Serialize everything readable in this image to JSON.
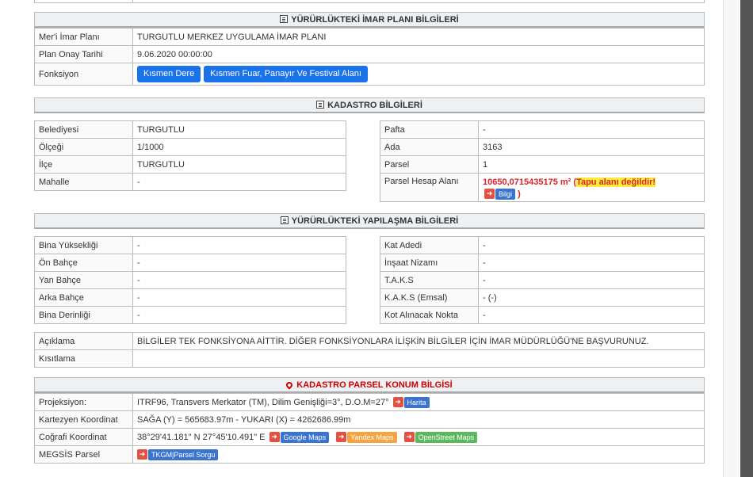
{
  "imar": {
    "title": "YÜRÜRLÜKTEKİ İMAR PLANI BİLGİLERİ",
    "rows": [
      {
        "label": "Mer'i İmar Planı",
        "value": "TURGUTLU MERKEZ UYGULAMA İMAR PLANI"
      },
      {
        "label": "Plan Onay Tarihi",
        "value": "9.06.2020 00:00:00"
      }
    ],
    "fonksiyon_label": "Fonksiyon",
    "fonksiyon_buttons": [
      "Kısmen Dere",
      "Kısmen Fuar, Panayır Ve Festival Alanı"
    ]
  },
  "kadastro": {
    "title": "KADASTRO BİLGİLERİ",
    "left": [
      {
        "label": "Belediyesi",
        "value": "TURGUTLU"
      },
      {
        "label": "Ölçeği",
        "value": "1/1000"
      },
      {
        "label": "İlçe",
        "value": "TURGUTLU"
      },
      {
        "label": "Mahalle",
        "value": "-"
      }
    ],
    "right": [
      {
        "label": "Pafta",
        "value": "-"
      },
      {
        "label": "Ada",
        "value": "3163"
      },
      {
        "label": "Parsel",
        "value": "1"
      }
    ],
    "alan_label": "Parsel Hesap Alanı",
    "alan_value": "10650,0715435175 m²",
    "alan_open": " (",
    "alan_warning": "Tapu alanı değildir!",
    "bilgi_label": "Bilgi",
    "alan_close": " )"
  },
  "yapilasma": {
    "title": "YÜRÜRLÜKTEKİ YAPILAŞMA BİLGİLERİ",
    "left": [
      {
        "label": "Bina Yüksekliği",
        "value": "-"
      },
      {
        "label": "Ön Bahçe",
        "value": "-"
      },
      {
        "label": "Yan Bahçe",
        "value": "-"
      },
      {
        "label": "Arka Bahçe",
        "value": "-"
      },
      {
        "label": "Bina Derinliği",
        "value": "-"
      }
    ],
    "right": [
      {
        "label": "Kat Adedi",
        "value": "-"
      },
      {
        "label": "İnşaat Nizamı",
        "value": "-"
      },
      {
        "label": "T.A.K.S",
        "value": "-"
      },
      {
        "label": "K.A.K.S (Emsal)",
        "value": "- (-)"
      },
      {
        "label": "Kot Alınacak Nokta",
        "value": "-"
      }
    ]
  },
  "aciklama": {
    "rows": [
      {
        "label": "Açıklama",
        "value": "BİLGİLER TEK FONKSİYONA AİTTİR. DİĞER FONKSİYONLARA İLİŞKİN BİLGİLER İÇİN İMAR MÜDÜRLÜĞÜ'NE BAŞVURUNUZ."
      },
      {
        "label": "Kısıtlama",
        "value": ""
      }
    ]
  },
  "konum": {
    "title": "KADASTRO PARSEL KONUM BİLGİSİ",
    "projeksiyon_label": "Projeksiyon:",
    "projeksiyon_value": "ITRF96, Transvers Merkator (TM), Dilim Genişliği=3°, D.O.M=27°",
    "harita_label": "Harita",
    "kartezyen_label": "Kartezyen Koordinat",
    "kartezyen_value": "SAĞA (Y) = 565683.97m - YUKARI (X) = 4262686.99m",
    "cografi_label": "Coğrafi Koordinat",
    "cografi_value": "38°29'41.181\" N 27°45'10.491\" E",
    "google_label": "Google Maps",
    "yandex_label": "Yandex Maps",
    "osm_label": "OpenStreet Maps",
    "megsis_label": "MEGSİS Parsel",
    "tkgm_label": "TKGM|Parsel Sorgu"
  },
  "colors": {
    "accent_blue": "#1a73e8",
    "warning_red": "#d9232d",
    "highlight_yellow": "#ffeb3b"
  }
}
